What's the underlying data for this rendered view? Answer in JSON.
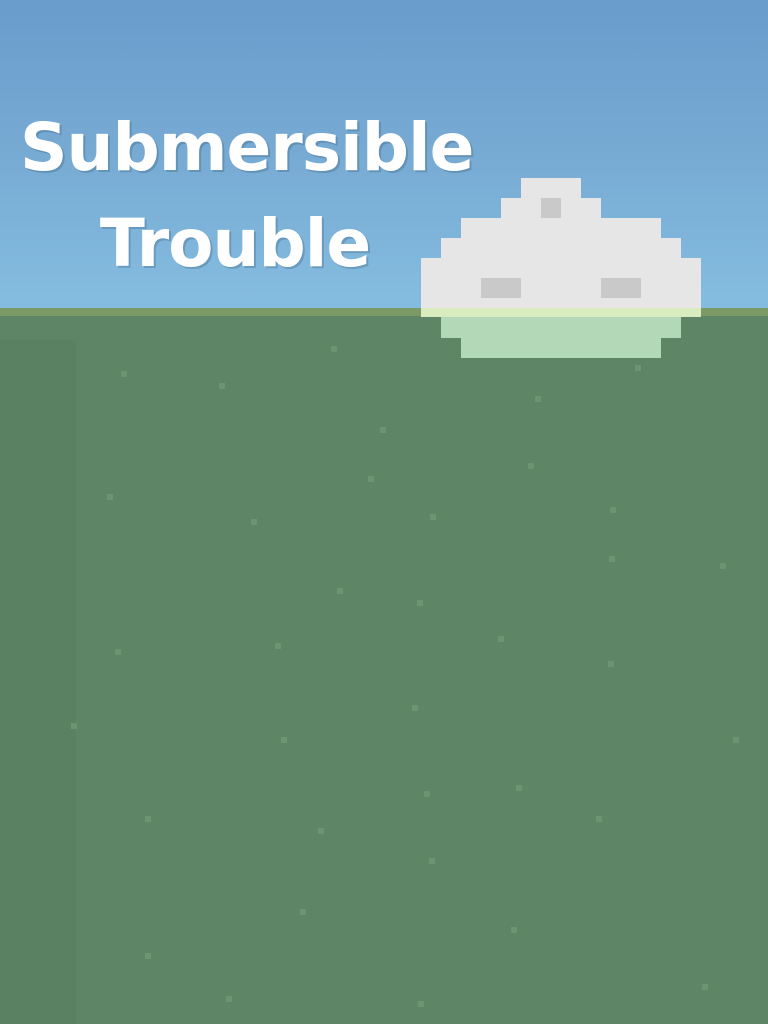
{
  "game": {
    "title_line1": "Submersible",
    "title_line2": "Trouble"
  },
  "colors": {
    "sky_top": "#6a9ccc",
    "sky_bottom": "#85bde0",
    "water": "#5e8566",
    "shoreline": "#7c9a66",
    "submarine_hull": "#e6e6e6",
    "submarine_window": "#c9c9c9",
    "submarine_waterline": "#d8ecc0",
    "submarine_submerged": "#b3d8b8",
    "bubble": "#6a9472",
    "title_text": "#ffffff"
  }
}
